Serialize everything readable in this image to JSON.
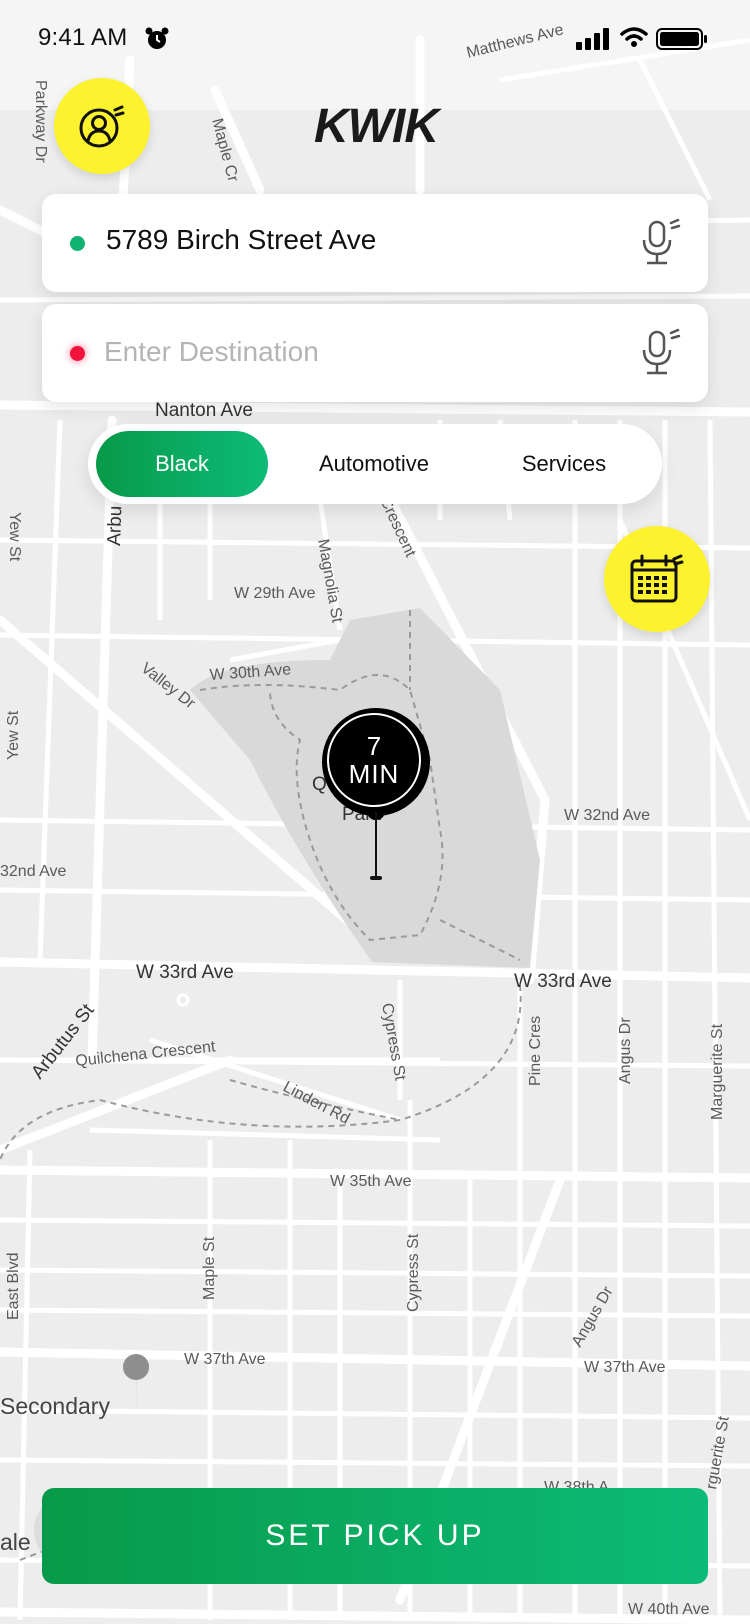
{
  "status_bar": {
    "time": "9:41 AM"
  },
  "app": {
    "logo_text": "KWIK"
  },
  "pickup": {
    "address": "5789 Birch Street Ave"
  },
  "destination": {
    "placeholder": "Enter Destination",
    "value": ""
  },
  "tabs": [
    {
      "label": "Black",
      "active": true
    },
    {
      "label": "Automotive",
      "active": false
    },
    {
      "label": "Services",
      "active": false
    }
  ],
  "eta": {
    "value": "7",
    "unit": "MIN"
  },
  "cta": {
    "label": "SET PICK UP"
  },
  "map": {
    "labels": {
      "matthews": "Matthews Ave",
      "parkway": "Parkway Dr",
      "maple_cr": "Maple Cr",
      "nanton": "Nanton Ave",
      "yew1": "Yew St",
      "yew2": "Yew St",
      "arbutus_top": "Arbu",
      "crescent": "Crescent",
      "w29": "W 29th Ave",
      "magnolia": "Magnolia St",
      "w30": "W 30th Ave",
      "valley": "Valley Dr",
      "w32_left": "32nd Ave",
      "w32_right": "W 32nd Ave",
      "park1": "Q",
      "park2": "Park",
      "w33_left": "W 33rd Ave",
      "w33_right": "W 33rd Ave",
      "arbutus": "Arbutus St",
      "quilchena": "Quilchena Crescent",
      "cypress1": "Cypress St",
      "linden": "Linden Rd",
      "pine": "Pine Cres",
      "angus1": "Angus Dr",
      "marguerite1": "Marguerite St",
      "w35": "W 35th Ave",
      "east": "East Blvd",
      "maple2": "Maple St",
      "cypress2": "Cypress St",
      "angus2": "Angus Dr",
      "w37_left": "W 37th Ave",
      "w37_right": "W 37th Ave",
      "secondary": "Secondary",
      "marguerite2": "rguerite St",
      "w38": "W 38th A",
      "dale": "ale",
      "w40": "W 40th Ave"
    }
  },
  "colors": {
    "accent_green": "#079a49",
    "accent_green_light": "#0dbb78",
    "yellow": "#fcf22e",
    "pickup_dot": "#0fb26e",
    "dest_dot": "#f2133d"
  }
}
